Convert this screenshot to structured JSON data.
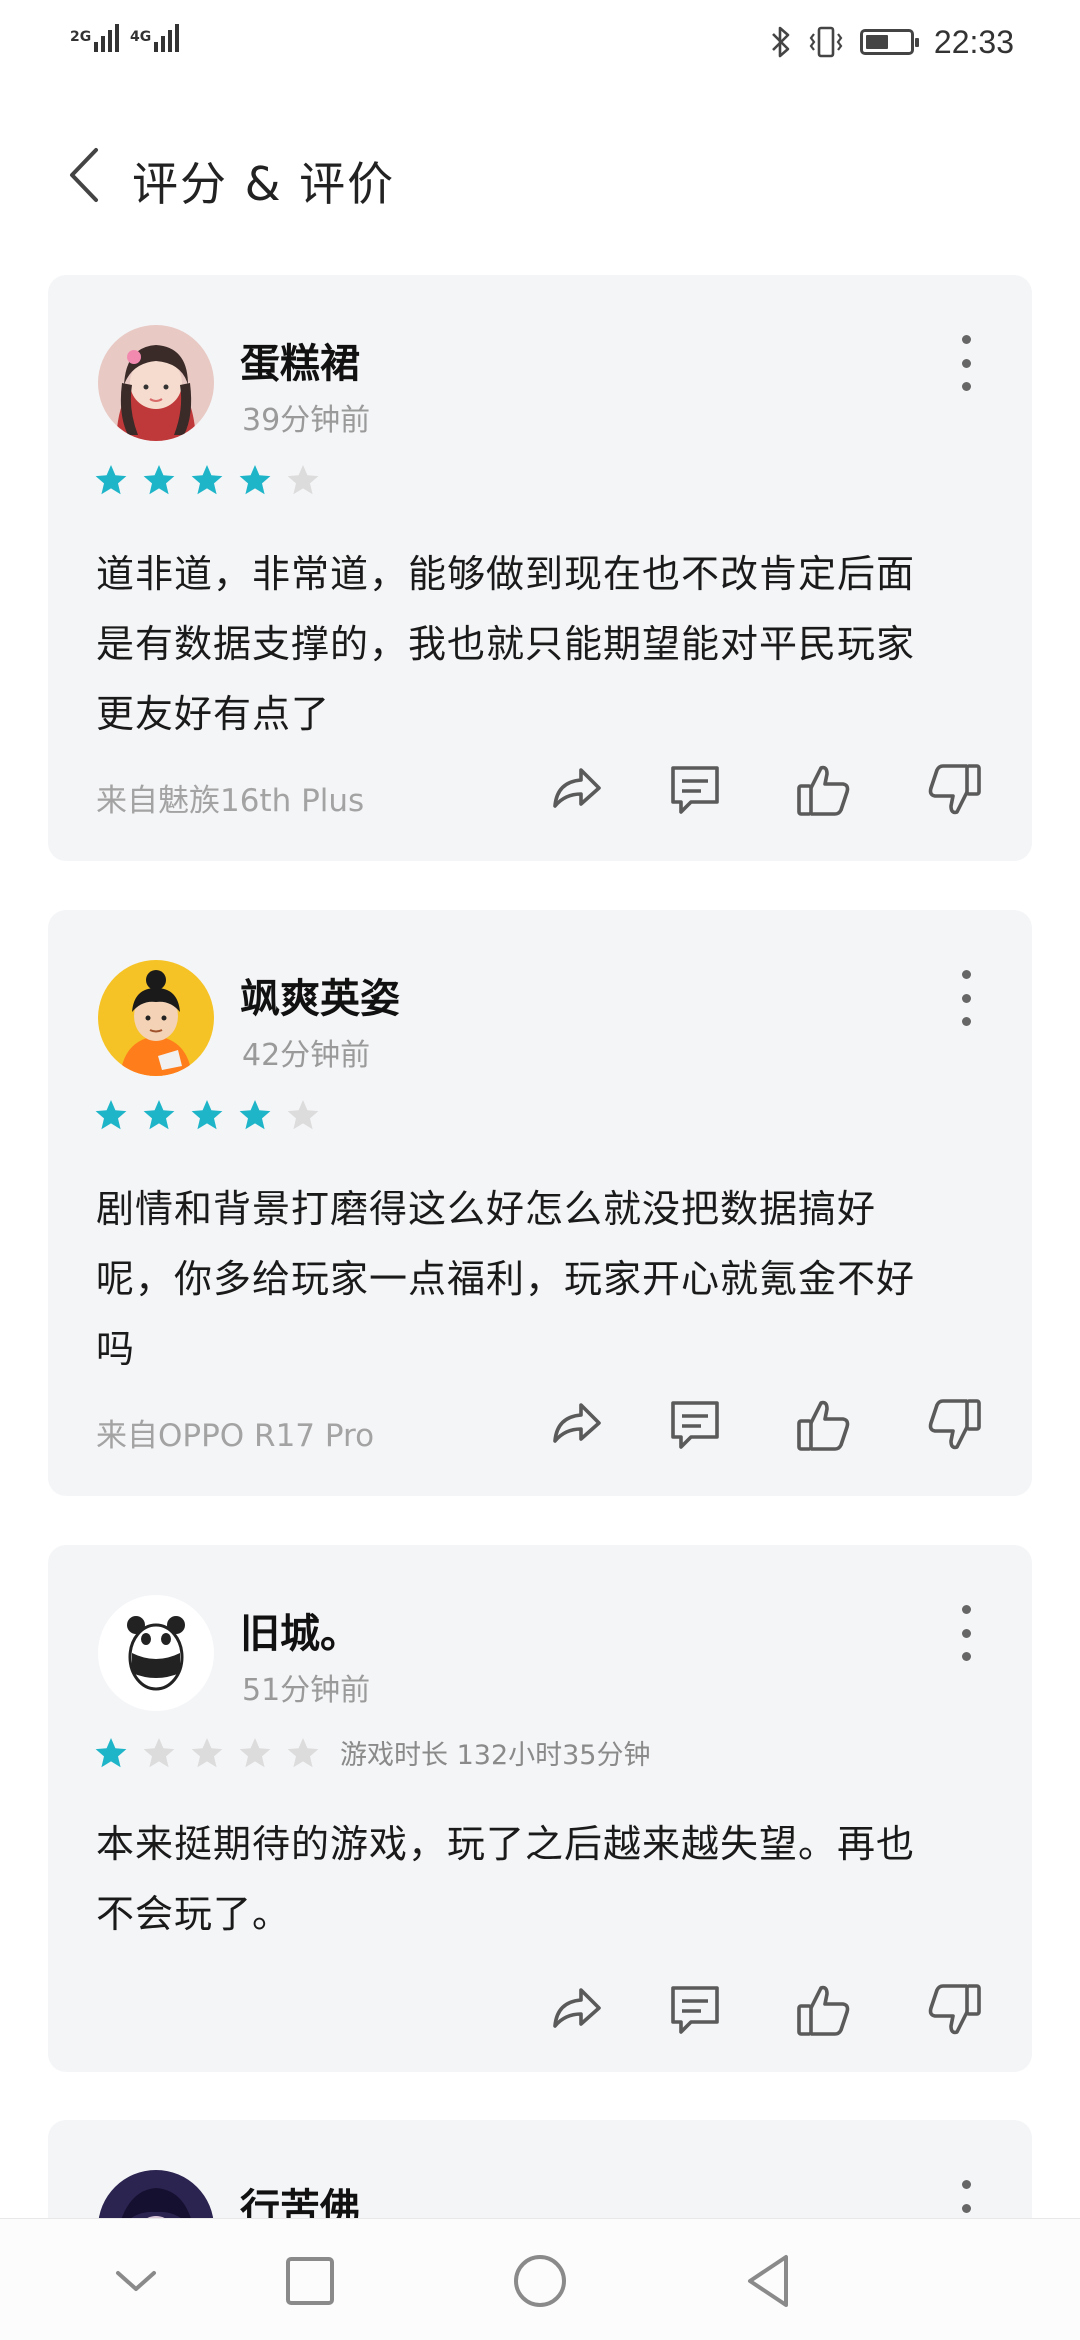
{
  "status_bar": {
    "signal_1": "2G",
    "signal_2": "4G",
    "time": "22:33",
    "icons": [
      "signal-icon",
      "bluetooth-icon",
      "vibrate-icon",
      "battery-icon"
    ]
  },
  "header": {
    "title": "评分 & 评价",
    "back_icon": "chevron-left-icon"
  },
  "reviews": [
    {
      "username": "蛋糕裙",
      "time": "39分钟前",
      "rating": 4,
      "playtime": "",
      "text_lines": [
        "道非道，非常道，能够做到现在也不改肯定后面",
        "是有数据支撑的，我也就只能期望能对平民玩家",
        "更友好有点了"
      ],
      "device": "来自魅族16th Plus"
    },
    {
      "username": "飒爽英姿",
      "time": "42分钟前",
      "rating": 4,
      "playtime": "",
      "text_lines": [
        "剧情和背景打磨得这么好怎么就没把数据搞好",
        "呢，你多给玩家一点福利，玩家开心就氪金不好",
        "吗"
      ],
      "device": "来自OPPO R17 Pro"
    },
    {
      "username": "旧城。",
      "time": "51分钟前",
      "rating": 1,
      "playtime": "游戏时长 132小时35分钟",
      "text_lines": [
        "本来挺期待的游戏，玩了之后越来越失望。再也",
        "不会玩了。"
      ],
      "device": ""
    },
    {
      "username": "行苦佛",
      "time": "",
      "rating": 0,
      "playtime": "",
      "text_lines": [],
      "device": ""
    }
  ],
  "actions": [
    "share-icon",
    "comment-icon",
    "thumbs-up-icon",
    "thumbs-down-icon"
  ],
  "colors": {
    "star_filled": "#1fb5c9",
    "star_empty": "#dcdcdc",
    "card_bg": "#f4f5f7",
    "icon_gray": "#5a5a5a"
  },
  "nav_bar": {
    "buttons": [
      "chevron-down-icon",
      "square-recents-icon",
      "circle-home-icon",
      "triangle-back-icon"
    ]
  }
}
